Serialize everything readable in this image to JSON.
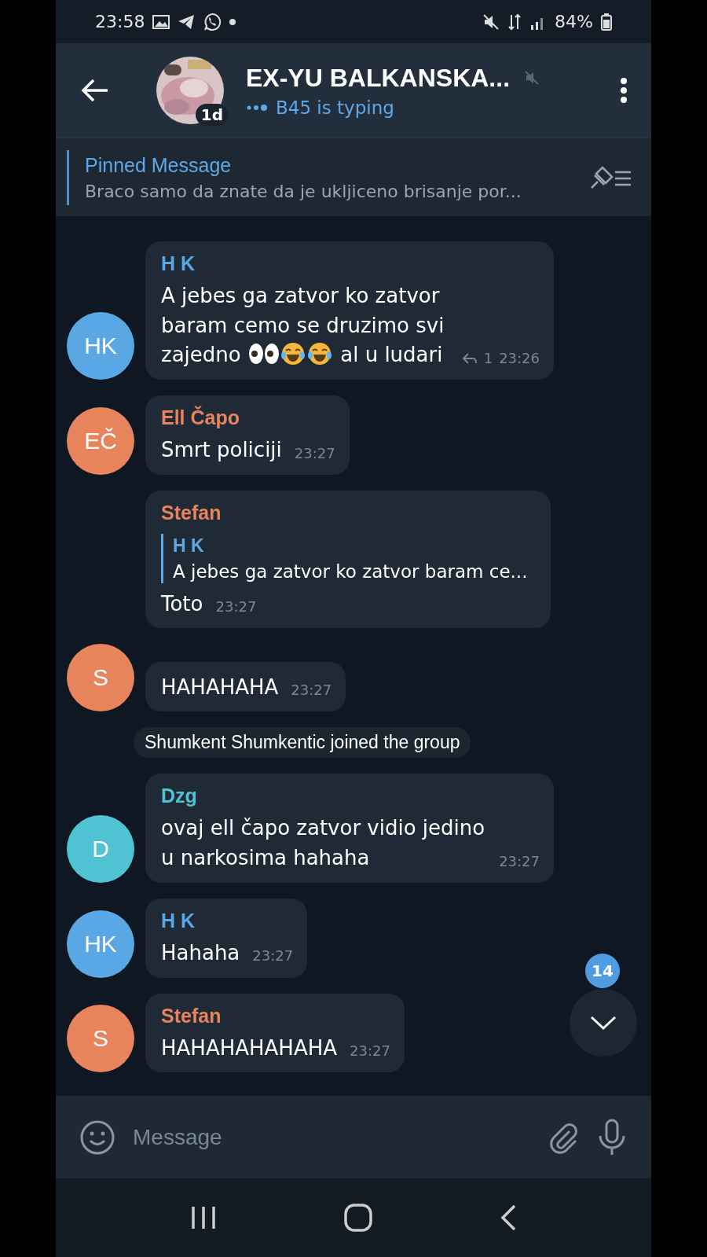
{
  "status_bar": {
    "time": "23:58",
    "battery": "84%"
  },
  "header": {
    "title": "EX-YU BALKANSKA...",
    "badge": "1d",
    "status": "B45 is typing",
    "muted": true
  },
  "pinned": {
    "label": "Pinned Message",
    "text": "Braco samo da znate da je ukljiceno brisanje por..."
  },
  "messages": [
    {
      "kind": "message",
      "sender": "H K",
      "color": "#5aa7e6",
      "avatar": "HK",
      "parts": [
        {
          "kind": "text",
          "text": "A jebes ga zatvor ko zatvor baram cemo se druzimo svi zajedno "
        },
        {
          "kind": "eyes"
        },
        {
          "kind": "laugh"
        },
        {
          "kind": "laugh"
        },
        {
          "kind": "text",
          "text": " al u ludari"
        }
      ],
      "replies": "1",
      "time": "23:26"
    },
    {
      "kind": "message",
      "sender": "Ell Čapo",
      "color": "#e8845c",
      "avatar": "EČ",
      "parts": [
        {
          "kind": "text",
          "text": "Smrt policiji"
        }
      ],
      "time": "23:27"
    },
    {
      "kind": "message",
      "sender": "Stefan",
      "color": "#e8845c",
      "quote": {
        "sender": "H K",
        "text": "A jebes ga zatvor ko zatvor baram ce..."
      },
      "parts": [
        {
          "kind": "text",
          "text": "Toto"
        }
      ],
      "time": "23:27"
    },
    {
      "kind": "message",
      "color": "#e8845c",
      "avatar": "S",
      "parts": [
        {
          "kind": "text",
          "text": "HAHAHAHA"
        }
      ],
      "time": "23:27"
    },
    {
      "kind": "service",
      "text": "Shumkent Shumkentic joined the group"
    },
    {
      "kind": "message",
      "sender": "Dzg",
      "color": "#4fc3d4",
      "avatar": "D",
      "parts": [
        {
          "kind": "text",
          "text": "ovaj ell čapo zatvor vidio jedino u narkosima hahaha"
        }
      ],
      "time": "23:27"
    },
    {
      "kind": "message",
      "sender": "H K",
      "color": "#5aa7e6",
      "avatar": "HK",
      "parts": [
        {
          "kind": "text",
          "text": "Hahaha"
        }
      ],
      "time": "23:27"
    },
    {
      "kind": "message",
      "sender": "Stefan",
      "color": "#e8845c",
      "avatar": "S",
      "parts": [
        {
          "kind": "text",
          "text": "HAHAHAHAHAHA"
        }
      ],
      "time": "23:27"
    }
  ],
  "scroll_badge": "14",
  "composer": {
    "placeholder": "Message"
  }
}
